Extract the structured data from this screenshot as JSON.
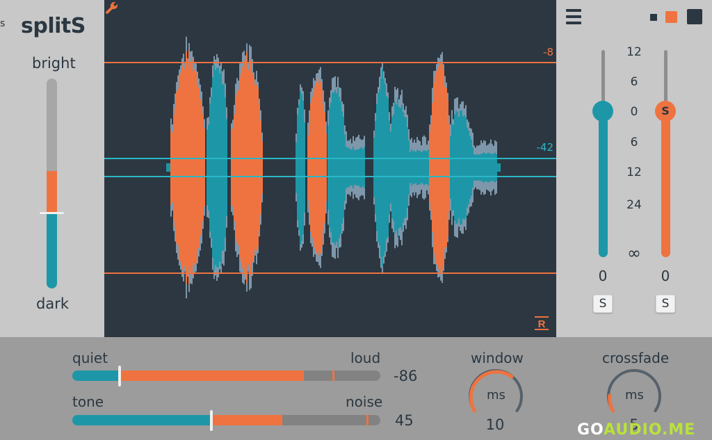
{
  "app": {
    "title": "splitS",
    "edge_glyph": "s"
  },
  "tone_slider": {
    "top_label": "bright",
    "bottom_label": "dark",
    "colors": {
      "upper": "#ef7340",
      "lower": "#1d97a7",
      "track": "#a7a7a7"
    }
  },
  "waveform": {
    "threshold_upper_label": "-8",
    "threshold_lower_label": "-42",
    "colors": {
      "background": "#2c3741",
      "loud": "#ef7340",
      "quiet": "#1d97a7",
      "envelope": "#7f97ab",
      "threshold_upper": "#ef7340",
      "threshold_lower": "#29b7c9"
    },
    "icons": {
      "settings": "wrench-icon",
      "reset": "r-icon"
    },
    "reset_label": "R"
  },
  "right_panel": {
    "menu_icon": "hamburger-icon",
    "size_buttons": [
      "small",
      "medium",
      "large"
    ],
    "scale": [
      "12",
      "6",
      "0",
      "6",
      "12",
      "24",
      "∞"
    ],
    "left_fader": {
      "value": "0",
      "solo_label": "S",
      "color": "#1d97a7"
    },
    "right_fader": {
      "value": "0",
      "solo_label": "S",
      "knob_label": "S",
      "color": "#ef7340"
    }
  },
  "bottom": {
    "quiet_loud": {
      "left_label": "quiet",
      "right_label": "loud",
      "value": "-86"
    },
    "tone_noise": {
      "left_label": "tone",
      "right_label": "noise",
      "value": "45"
    },
    "window": {
      "label": "window",
      "unit": "ms",
      "value": "10"
    },
    "crossfade": {
      "label": "crossfade",
      "unit": "ms",
      "value": "5"
    }
  },
  "watermark": {
    "part1": "GO",
    "part2": "AUDIO.ME"
  }
}
